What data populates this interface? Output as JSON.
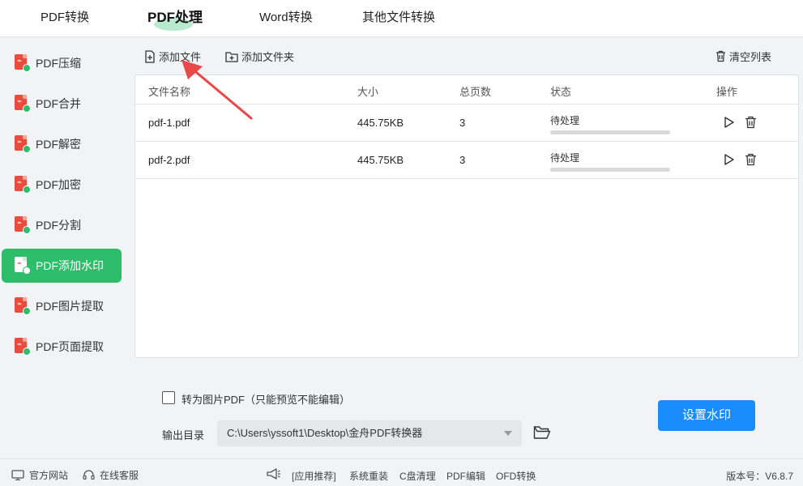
{
  "top_tabs": [
    "PDF转换",
    "PDF处理",
    "Word转换",
    "其他文件转换"
  ],
  "active_tab_index": 1,
  "sidebar": {
    "items": [
      {
        "label": "PDF压缩",
        "badge": "compress"
      },
      {
        "label": "PDF合并",
        "badge": "merge"
      },
      {
        "label": "PDF解密",
        "badge": "unlock"
      },
      {
        "label": "PDF加密",
        "badge": "lock"
      },
      {
        "label": "PDF分割",
        "badge": "split"
      },
      {
        "label": "PDF添加水印",
        "badge": "watermark"
      },
      {
        "label": "PDF图片提取",
        "badge": "image"
      },
      {
        "label": "PDF页面提取",
        "badge": "page"
      }
    ],
    "active_index": 5
  },
  "toolbar": {
    "add_file": "添加文件",
    "add_folder": "添加文件夹",
    "clear_list": "清空列表"
  },
  "table": {
    "headers": [
      "文件名称",
      "大小",
      "总页数",
      "状态",
      "操作"
    ],
    "rows": [
      {
        "name": "pdf-1.pdf",
        "size": "445.75KB",
        "pages": "3",
        "status": "待处理",
        "progress": 0
      },
      {
        "name": "pdf-2.pdf",
        "size": "445.75KB",
        "pages": "3",
        "status": "待处理",
        "progress": 0
      }
    ]
  },
  "options": {
    "to_image_pdf_label": "转为图片PDF（只能预览不能编辑）",
    "to_image_pdf_checked": false,
    "output_label": "输出目录",
    "output_path": "C:\\Users\\yssoft1\\Desktop\\金舟PDF转换器",
    "action_button": "设置水印"
  },
  "statusbar": {
    "website": "官方网站",
    "support": "在线客服",
    "links": [
      "[应用推荐]",
      "系统重装",
      "C盘清理",
      "PDF编辑",
      "OFD转换"
    ],
    "version": "版本号：V6.8.7"
  },
  "colors": {
    "accent_green": "#2ebd6a",
    "primary_blue": "#1a8cff",
    "pdf_red": "#e94b3c",
    "annotation_arrow": "#e84848"
  },
  "icons": {
    "add_file": "file-plus-icon",
    "add_folder": "folder-plus-icon",
    "clear_list": "trash-icon",
    "row_start": "play-icon",
    "row_delete": "trash-icon",
    "browse_folder": "folder-open-icon",
    "website": "monitor-icon",
    "support": "headset-icon",
    "recommend": "megaphone-icon"
  }
}
